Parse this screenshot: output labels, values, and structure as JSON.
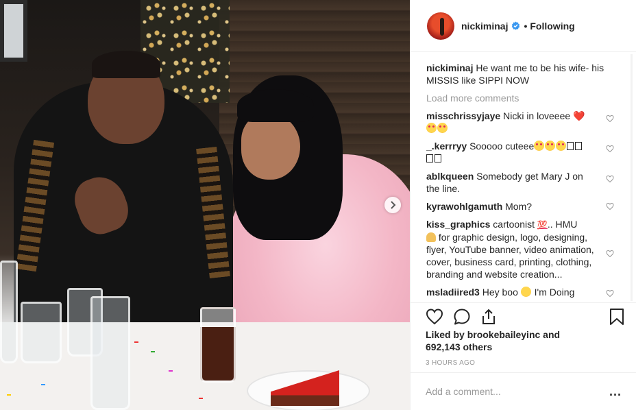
{
  "post": {
    "username": "nickiminaj",
    "follow_status": "Following",
    "separator": "•",
    "caption_text": "He want me to be his wife- his MISSIS like SIPPI NOW"
  },
  "comments": {
    "load_more": "Load more comments",
    "items": [
      {
        "user": "misschrissyjaye",
        "text": "Nicki in loveeee"
      },
      {
        "user": "_.kerrryy",
        "text": "Sooooo cuteee"
      },
      {
        "user": "ablkqueen",
        "text": "Somebody get Mary J on the line."
      },
      {
        "user": "kyrawohlgamuth",
        "text": "Mom?"
      },
      {
        "user": "kiss_graphics",
        "text_a": "cartoonist",
        "text_b": ".. HMU",
        "text_c": "for graphic design, logo, designing, flyer, YouTube banner, video animation, cover, business card, printing, clothing, branding and website creation..."
      },
      {
        "user": "msladiired3",
        "text_a": "Hey boo",
        "text_b": "I'm Doing"
      }
    ]
  },
  "engagement": {
    "liked_by_prefix": "Liked by",
    "liked_by_user": "brookebaileyinc",
    "and": "and",
    "others_count": "692,143 others",
    "time_ago": "3 HOURS AGO"
  },
  "composer": {
    "placeholder": "Add a comment...",
    "more": "..."
  },
  "icons": {
    "verified": "verified-badge-icon",
    "like": "heart-icon",
    "comment": "comment-icon",
    "share": "share-icon",
    "save": "bookmark-icon",
    "next": "chevron-right-icon"
  },
  "colors": {
    "verified_blue": "#3897f0",
    "text": "#262626",
    "muted": "#999999",
    "heart_red": "#e0245e"
  }
}
